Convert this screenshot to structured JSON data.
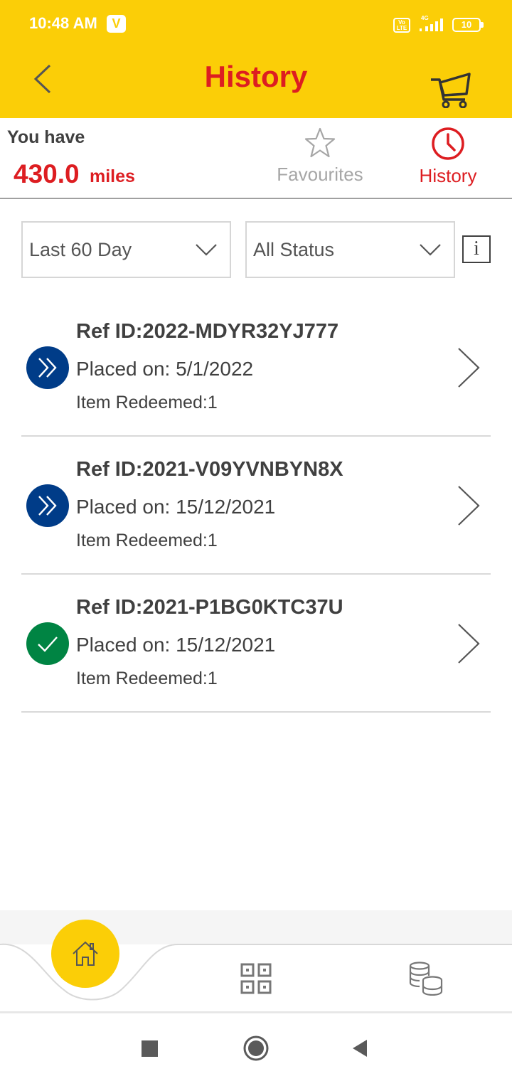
{
  "status_bar": {
    "time": "10:48 AM",
    "carrier_badge": "V",
    "network_type": "VoLTE",
    "battery_level": "10"
  },
  "header": {
    "title": "History",
    "icons": {
      "back": "chevron-left-icon",
      "cart": "shopping-cart-icon"
    }
  },
  "summary": {
    "label": "You have",
    "miles_value": "430.0",
    "miles_unit": "miles"
  },
  "tabs": [
    {
      "label": "Favourites",
      "icon": "star-icon",
      "active": false
    },
    {
      "label": "History",
      "icon": "clock-icon",
      "active": true
    }
  ],
  "filters": {
    "period": "Last 60 Day",
    "status": "All Status",
    "info_label": "i"
  },
  "orders": [
    {
      "ref_id": "Ref ID:2022-MDYR32YJ777",
      "placed_on": "Placed on: 5/1/2022",
      "items_redeemed": "Item Redeemed:1",
      "status": "processing"
    },
    {
      "ref_id": "Ref ID:2021-V09YVNBYN8X",
      "placed_on": "Placed on: 15/12/2021",
      "items_redeemed": "Item Redeemed:1",
      "status": "processing"
    },
    {
      "ref_id": "Ref ID:2021-P1BG0KTC37U",
      "placed_on": "Placed on: 15/12/2021",
      "items_redeemed": "Item Redeemed:1",
      "status": "complete"
    }
  ],
  "bottom_nav": {
    "items": [
      {
        "icon": "home-icon",
        "active": true
      },
      {
        "icon": "qr-code-icon",
        "active": false
      },
      {
        "icon": "coins-icon",
        "active": false
      }
    ]
  },
  "colors": {
    "brand_yellow": "#FBCE07",
    "brand_red": "#DD1D21",
    "status_processing": "#003C88",
    "status_complete": "#008443",
    "text": "#404040"
  }
}
